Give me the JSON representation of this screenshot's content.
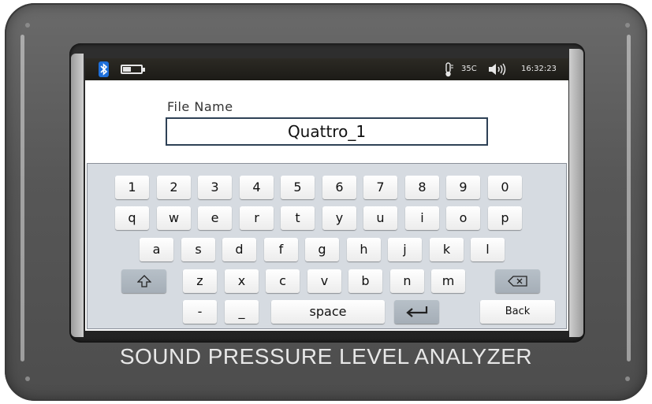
{
  "status_bar": {
    "bluetooth_icon": "bluetooth-icon",
    "battery_icon": "battery-icon",
    "thermometer_icon": "thermometer-icon",
    "temperature": "35C",
    "speaker_icon": "speaker-icon",
    "time": "16:32:23"
  },
  "file_name": {
    "label": "File Name",
    "value": "Quattro_1"
  },
  "keyboard": {
    "row_numbers": [
      "1",
      "2",
      "3",
      "4",
      "5",
      "6",
      "7",
      "8",
      "9",
      "0"
    ],
    "row_1": [
      "q",
      "w",
      "e",
      "r",
      "t",
      "y",
      "u",
      "i",
      "o",
      "p"
    ],
    "row_2": [
      "a",
      "s",
      "d",
      "f",
      "g",
      "h",
      "j",
      "k",
      "l"
    ],
    "row_3": [
      "z",
      "x",
      "c",
      "v",
      "b",
      "n",
      "m"
    ],
    "shift_icon": "shift-arrow-icon",
    "backspace_icon": "backspace-icon",
    "dash": "-",
    "underscore": "_",
    "space": "space",
    "enter_icon": "enter-arrow-icon",
    "back": "Back"
  },
  "device_title": "SOUND PRESSURE LEVEL ANALYZER"
}
